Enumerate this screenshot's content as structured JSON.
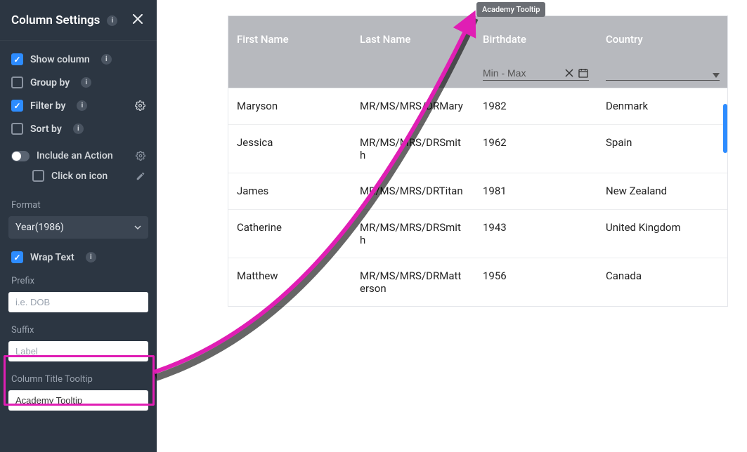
{
  "panel": {
    "title": "Column Settings",
    "options": {
      "showColumn": {
        "label": "Show column",
        "checked": true
      },
      "groupBy": {
        "label": "Group by",
        "checked": false
      },
      "filterBy": {
        "label": "Filter by",
        "checked": true
      },
      "sortBy": {
        "label": "Sort by",
        "checked": false
      }
    },
    "includeAction": {
      "label": "Include an Action"
    },
    "clickOnIcon": {
      "label": "Click on icon"
    },
    "format": {
      "label": "Format",
      "value": "Year(1986)"
    },
    "wrapText": {
      "label": "Wrap Text",
      "checked": true
    },
    "prefix": {
      "label": "Prefix",
      "placeholder": "i.e. DOB",
      "value": ""
    },
    "suffix": {
      "label": "Suffix",
      "placeholder": "Label",
      "value": ""
    },
    "tooltip": {
      "label": "Column Title Tooltip",
      "value": "Academy Tooltip"
    }
  },
  "tooltipText": "Academy Tooltip",
  "table": {
    "headers": {
      "firstName": "First Name",
      "lastName": "Last Name",
      "birthdate": "Birthdate",
      "country": "Country"
    },
    "birthdateFilter": {
      "placeholder": "Min - Max"
    },
    "rows": [
      {
        "firstName": "Maryson",
        "lastName": "MR/MS/MRS/DRMary",
        "birthdate": "1982",
        "country": "Denmark"
      },
      {
        "firstName": "Jessica",
        "lastName": "MR/MS/MRS/DRSmith",
        "birthdate": "1962",
        "country": "Spain"
      },
      {
        "firstName": "James",
        "lastName": "MR/MS/MRS/DRTitan",
        "birthdate": "1981",
        "country": "New Zealand"
      },
      {
        "firstName": "Catherine",
        "lastName": "MR/MS/MRS/DRSmith",
        "birthdate": "1943",
        "country": "United Kingdom"
      },
      {
        "firstName": "Matthew",
        "lastName": "MR/MS/MRS/DRMatterson",
        "birthdate": "1956",
        "country": "Canada"
      }
    ]
  },
  "annotation": {
    "highlightColor": "#e01eb4"
  }
}
